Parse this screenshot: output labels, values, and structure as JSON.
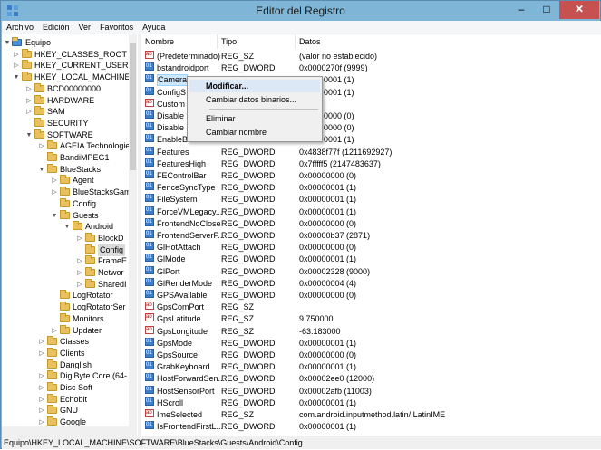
{
  "window": {
    "title": "Editor del Registro",
    "minimize": "–",
    "maximize": "□",
    "close": "✕",
    "frame_color": "#7fb5d6",
    "close_color": "#c75050"
  },
  "menu": [
    "Archivo",
    "Edición",
    "Ver",
    "Favoritos",
    "Ayuda"
  ],
  "tree": [
    {
      "label": "Equipo",
      "level": 0,
      "toggle": "▼"
    },
    {
      "label": "HKEY_CLASSES_ROOT",
      "level": 1,
      "toggle": "▷"
    },
    {
      "label": "HKEY_CURRENT_USER",
      "level": 1,
      "toggle": "▷"
    },
    {
      "label": "HKEY_LOCAL_MACHINE",
      "level": 1,
      "toggle": "▼"
    },
    {
      "label": "BCD00000000",
      "level": 2,
      "toggle": "▷"
    },
    {
      "label": "HARDWARE",
      "level": 2,
      "toggle": "▷"
    },
    {
      "label": "SAM",
      "level": 2,
      "toggle": "▷"
    },
    {
      "label": "SECURITY",
      "level": 2,
      "toggle": ""
    },
    {
      "label": "SOFTWARE",
      "level": 2,
      "toggle": "▼"
    },
    {
      "label": "AGEIA Technologie",
      "level": 3,
      "toggle": "▷"
    },
    {
      "label": "BandiMPEG1",
      "level": 3,
      "toggle": ""
    },
    {
      "label": "BlueStacks",
      "level": 3,
      "toggle": "▼"
    },
    {
      "label": "Agent",
      "level": 4,
      "toggle": "▷"
    },
    {
      "label": "BlueStacksGam",
      "level": 4,
      "toggle": "▷"
    },
    {
      "label": "Config",
      "level": 4,
      "toggle": ""
    },
    {
      "label": "Guests",
      "level": 4,
      "toggle": "▼"
    },
    {
      "label": "Android",
      "level": 5,
      "toggle": "▼"
    },
    {
      "label": "BlockD",
      "level": 6,
      "toggle": "▷"
    },
    {
      "label": "Config",
      "level": 6,
      "toggle": "",
      "selected": true
    },
    {
      "label": "FrameE",
      "level": 6,
      "toggle": "▷"
    },
    {
      "label": "Networ",
      "level": 6,
      "toggle": "▷"
    },
    {
      "label": "SharedI",
      "level": 6,
      "toggle": "▷"
    },
    {
      "label": "LogRotator",
      "level": 4,
      "toggle": ""
    },
    {
      "label": "LogRotatorSer",
      "level": 4,
      "toggle": ""
    },
    {
      "label": "Monitors",
      "level": 4,
      "toggle": ""
    },
    {
      "label": "Updater",
      "level": 4,
      "toggle": "▷"
    },
    {
      "label": "Classes",
      "level": 3,
      "toggle": "▷"
    },
    {
      "label": "Clients",
      "level": 3,
      "toggle": "▷"
    },
    {
      "label": "Danglish",
      "level": 3,
      "toggle": ""
    },
    {
      "label": "DigiByte Core (64-",
      "level": 3,
      "toggle": "▷"
    },
    {
      "label": "Disc Soft",
      "level": 3,
      "toggle": "▷"
    },
    {
      "label": "Echobit",
      "level": 3,
      "toggle": "▷"
    },
    {
      "label": "GNU",
      "level": 3,
      "toggle": "▷"
    },
    {
      "label": "Google",
      "level": 3,
      "toggle": "▷"
    }
  ],
  "columns": {
    "name": "Nombre",
    "type": "Tipo",
    "data": "Datos"
  },
  "values": [
    {
      "name": "(Predeterminado)",
      "type": "REG_SZ",
      "data": "(valor no establecido)",
      "icon": "str"
    },
    {
      "name": "bstandroidport",
      "type": "REG_DWORD",
      "data": "0x0000270f (9999)",
      "icon": "bin"
    },
    {
      "name": "Camera",
      "type": "",
      "data": "0001 (1)",
      "icon": "bin",
      "selected": true
    },
    {
      "name": "ConfigS",
      "type": "",
      "data": "0001 (1)",
      "icon": "bin"
    },
    {
      "name": "Custom",
      "type": "",
      "data": "",
      "icon": "str"
    },
    {
      "name": "Disable",
      "type": "",
      "data": "0000 (0)",
      "icon": "bin"
    },
    {
      "name": "Disable",
      "type": "",
      "data": "0000 (0)",
      "icon": "bin"
    },
    {
      "name": "EnableB",
      "type": "",
      "data": "0001 (1)",
      "icon": "bin"
    },
    {
      "name": "Features",
      "type": "REG_DWORD",
      "data": "0x4838f77f (1211692927)",
      "icon": "bin"
    },
    {
      "name": "FeaturesHigh",
      "type": "REG_DWORD",
      "data": "0x7fffff5 (2147483637)",
      "icon": "bin"
    },
    {
      "name": "FEControlBar",
      "type": "REG_DWORD",
      "data": "0x00000000 (0)",
      "icon": "bin"
    },
    {
      "name": "FenceSyncType",
      "type": "REG_DWORD",
      "data": "0x00000001 (1)",
      "icon": "bin"
    },
    {
      "name": "FileSystem",
      "type": "REG_DWORD",
      "data": "0x00000001 (1)",
      "icon": "bin"
    },
    {
      "name": "ForceVMLegacy...",
      "type": "REG_DWORD",
      "data": "0x00000001 (1)",
      "icon": "bin"
    },
    {
      "name": "FrontendNoClose",
      "type": "REG_DWORD",
      "data": "0x00000000 (0)",
      "icon": "bin"
    },
    {
      "name": "FrontendServerP...",
      "type": "REG_DWORD",
      "data": "0x00000b37 (2871)",
      "icon": "bin"
    },
    {
      "name": "GlHotAttach",
      "type": "REG_DWORD",
      "data": "0x00000000 (0)",
      "icon": "bin"
    },
    {
      "name": "GlMode",
      "type": "REG_DWORD",
      "data": "0x00000001 (1)",
      "icon": "bin"
    },
    {
      "name": "GlPort",
      "type": "REG_DWORD",
      "data": "0x00002328 (9000)",
      "icon": "bin"
    },
    {
      "name": "GlRenderMode",
      "type": "REG_DWORD",
      "data": "0x00000004 (4)",
      "icon": "bin"
    },
    {
      "name": "GPSAvailable",
      "type": "REG_DWORD",
      "data": "0x00000000 (0)",
      "icon": "bin"
    },
    {
      "name": "GpsComPort",
      "type": "REG_SZ",
      "data": "",
      "icon": "str"
    },
    {
      "name": "GpsLatitude",
      "type": "REG_SZ",
      "data": "9.750000",
      "icon": "str"
    },
    {
      "name": "GpsLongitude",
      "type": "REG_SZ",
      "data": "-63.183000",
      "icon": "str"
    },
    {
      "name": "GpsMode",
      "type": "REG_DWORD",
      "data": "0x00000001 (1)",
      "icon": "bin"
    },
    {
      "name": "GpsSource",
      "type": "REG_DWORD",
      "data": "0x00000000 (0)",
      "icon": "bin"
    },
    {
      "name": "GrabKeyboard",
      "type": "REG_DWORD",
      "data": "0x00000001 (1)",
      "icon": "bin"
    },
    {
      "name": "HostForwardSen...",
      "type": "REG_DWORD",
      "data": "0x00002ee0 (12000)",
      "icon": "bin"
    },
    {
      "name": "HostSensorPort",
      "type": "REG_DWORD",
      "data": "0x00002afb (11003)",
      "icon": "bin"
    },
    {
      "name": "HScroll",
      "type": "REG_DWORD",
      "data": "0x00000001 (1)",
      "icon": "bin"
    },
    {
      "name": "ImeSelected",
      "type": "REG_SZ",
      "data": "com.android.inputmethod.latin/.LatinIME",
      "icon": "str"
    },
    {
      "name": "IsFrontendFirstL...",
      "type": "REG_DWORD",
      "data": "0x00000001 (1)",
      "icon": "bin"
    }
  ],
  "context_menu": {
    "items": [
      "Modificar...",
      "Cambiar datos binarios...",
      "Eliminar",
      "Cambiar nombre"
    ]
  },
  "status_bar": "Equipo\\HKEY_LOCAL_MACHINE\\SOFTWARE\\BlueStacks\\Guests\\Android\\Config"
}
